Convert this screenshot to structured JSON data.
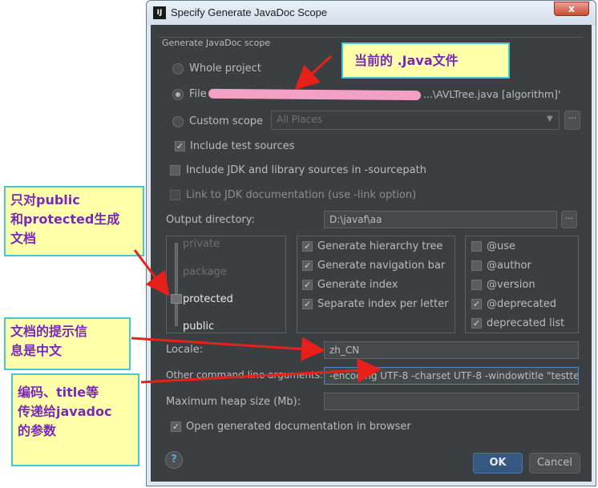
{
  "window": {
    "title": "Specify Generate JavaDoc Scope",
    "close": "x",
    "app_icon": "IJ"
  },
  "scope": {
    "group_title": "Generate JavaDoc scope",
    "whole_project": "Whole project",
    "file_label": "File",
    "file_value": "...\\AVLTree.java [algorithm]'",
    "custom_scope": "Custom scope",
    "custom_scope_value": "All Places",
    "include_test": "Include test sources",
    "include_jdk": "Include JDK and library sources in -sourcepath",
    "link_jdk": "Link to JDK documentation (use -link option)"
  },
  "output": {
    "label": "Output directory:",
    "value": "D:\\javaf\\aa"
  },
  "visibility": {
    "private": "private",
    "package": "package",
    "protected": "protected",
    "public": "public"
  },
  "generate": {
    "hierarchy": "Generate hierarchy tree",
    "navigation": "Generate navigation bar",
    "index": "Generate index",
    "separate": "Separate index per letter"
  },
  "tags": {
    "use": "@use",
    "author": "@author",
    "version": "@version",
    "deprecated": "@deprecated",
    "deprecated_list": "deprecated list"
  },
  "locale": {
    "label": "Locale:",
    "value": "zh_CN"
  },
  "cmd": {
    "label": "Other command line arguments:",
    "value": "-encoding UTF-8 -charset UTF-8 -windowtitle \"testte"
  },
  "heap": {
    "label": "Maximum heap size (Mb):",
    "value": ""
  },
  "open_browser": "Open generated documentation in browser",
  "buttons": {
    "ok": "OK",
    "cancel": "Cancel",
    "help": "?"
  },
  "annotations": {
    "java_file": "当前的 .Java文件",
    "public_protected": "只对public\n和protected生成\n文档",
    "locale_note": "文档的提示信\n息是中文",
    "encoding_note": "编码、title等\n传递给javadoc\n的参数"
  },
  "colors": {
    "note_bg": "#ffffaa",
    "note_border": "#46c8d2",
    "note_text": "#7a28b8",
    "arrow": "#e8201a"
  }
}
